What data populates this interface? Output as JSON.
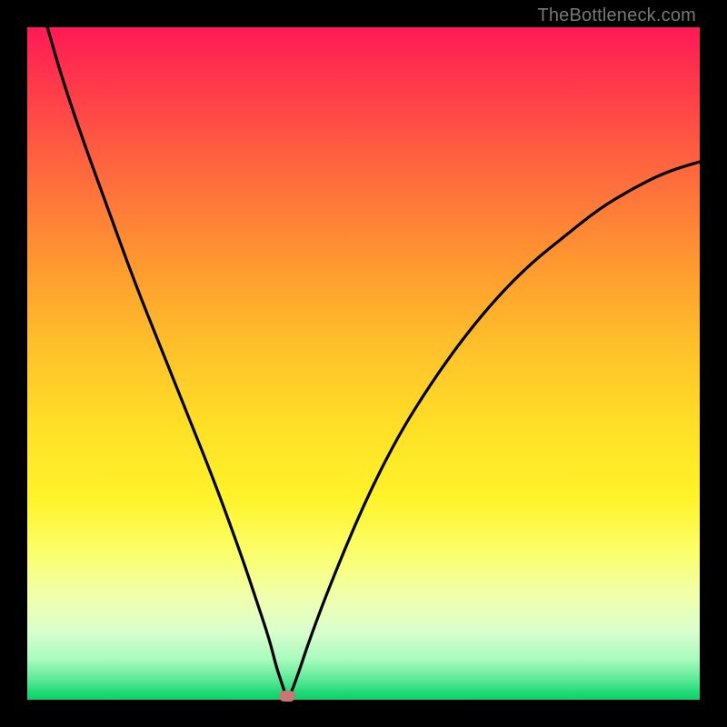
{
  "watermark": "TheBottleneck.com",
  "colors": {
    "frame_bg": "#000000",
    "curve": "#000000",
    "marker": "#c97772",
    "watermark_text": "#777777"
  },
  "chart_data": {
    "type": "line",
    "title": "",
    "xlabel": "",
    "ylabel": "",
    "xlim": [
      0,
      100
    ],
    "ylim": [
      0,
      100
    ],
    "grid": false,
    "legend": false,
    "annotations": [],
    "series": [
      {
        "name": "bottleneck-curve",
        "x": [
          3,
          5,
          8,
          12,
          16,
          20,
          24,
          28,
          32,
          34,
          36,
          37,
          38,
          38.5,
          39,
          40,
          42,
          45,
          50,
          55,
          60,
          65,
          70,
          75,
          80,
          85,
          90,
          95,
          100
        ],
        "y": [
          100,
          93,
          84,
          73,
          62,
          52,
          42,
          32,
          21,
          15,
          9,
          5,
          2,
          0.5,
          0.5,
          3,
          9,
          17,
          29,
          39,
          47,
          54,
          60,
          65,
          69,
          73,
          76,
          78.5,
          80
        ]
      }
    ],
    "marker": {
      "x": 38.7,
      "y": 0.5
    }
  }
}
